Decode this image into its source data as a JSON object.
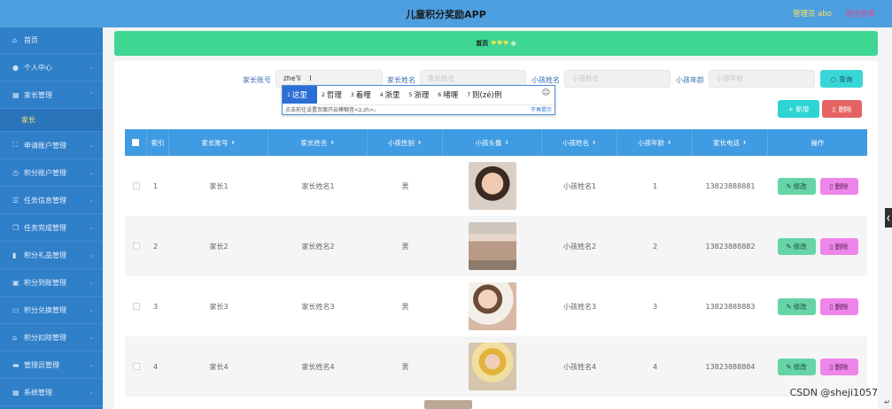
{
  "header": {
    "title": "儿童积分奖励APP",
    "admin": "管理员 abo",
    "logout": "退出登录"
  },
  "sidebar": {
    "items": [
      {
        "label": "首页",
        "icon": "home-icon"
      },
      {
        "label": "个人中心",
        "icon": "user-icon"
      },
      {
        "label": "家长管理",
        "icon": "grid-icon"
      },
      {
        "label": "家长",
        "sub": true
      },
      {
        "label": "申请账户管理",
        "icon": "expand-icon"
      },
      {
        "label": "积分账户管理",
        "icon": "clock-icon"
      },
      {
        "label": "任务信息管理",
        "icon": "list-icon"
      },
      {
        "label": "任务完成管理",
        "icon": "copy-icon"
      },
      {
        "label": "积分礼品管理",
        "icon": "bar-chart-icon"
      },
      {
        "label": "积分到账管理",
        "icon": "image-icon"
      },
      {
        "label": "积分兑换管理",
        "icon": "message-icon"
      },
      {
        "label": "积分扣除管理",
        "icon": "bank-icon"
      },
      {
        "label": "管理员管理",
        "icon": "card-icon"
      },
      {
        "label": "系统管理",
        "icon": "grid-icon"
      }
    ]
  },
  "breadcrumb": {
    "home": "首页",
    "hearts": "♥♥♥",
    "dot": "●"
  },
  "filters": {
    "parent_account_label": "家长账号",
    "parent_account_value": "zhe'li",
    "parent_name_label": "家长姓名",
    "parent_name_placeholder": "家长姓名",
    "child_name_label": "小孩姓名",
    "child_name_placeholder": "小孩姓名",
    "child_age_label": "小孩年龄",
    "child_age_placeholder": "小孩年龄",
    "search_label": "查询"
  },
  "ime": {
    "candidates": [
      {
        "n": "1",
        "text": "这里"
      },
      {
        "n": "2",
        "text": "哲理"
      },
      {
        "n": "3",
        "text": "着哩"
      },
      {
        "n": "4",
        "text": "浙里"
      },
      {
        "n": "5",
        "text": "浙理"
      },
      {
        "n": "6",
        "text": "啫喱"
      },
      {
        "n": "7",
        "text": "则(zé)例"
      }
    ],
    "hint": "点击前往设置页面开启模糊音<z,zh>。",
    "no_more": "不再提示",
    "emoji": "☺"
  },
  "actions": {
    "add_label": "+ 新增",
    "delete_label": "删除"
  },
  "table": {
    "headers": [
      "索引",
      "家长账号",
      "家长姓名",
      "小孩性别",
      "小孩头像",
      "小孩姓名",
      "小孩年龄",
      "家长电话",
      "操作"
    ],
    "rows": [
      {
        "index": "1",
        "account": "家长1",
        "name": "家长姓名1",
        "gender": "男",
        "child": "小孩姓名1",
        "age": "1",
        "phone": "13823888881"
      },
      {
        "index": "2",
        "account": "家长2",
        "name": "家长姓名2",
        "gender": "男",
        "child": "小孩姓名2",
        "age": "2",
        "phone": "13823888882"
      },
      {
        "index": "3",
        "account": "家长3",
        "name": "家长姓名3",
        "gender": "男",
        "child": "小孩姓名3",
        "age": "3",
        "phone": "13823888883"
      },
      {
        "index": "4",
        "account": "家长4",
        "name": "家长姓名4",
        "gender": "男",
        "child": "小孩姓名4",
        "age": "4",
        "phone": "13823888884"
      }
    ],
    "edit_label": "修改",
    "delete_label": "删除"
  },
  "watermark": "CSDN @sheji1057",
  "colors": {
    "topbar": "#4e9fe0",
    "sidebar": "#2f7fc9",
    "breadcrumb": "#3ed693",
    "table_header": "#3f9be2",
    "edit": "#66d4a6",
    "delete_row": "#ee86ea",
    "delete_bulk": "#e66363",
    "add": "#2ed4d4"
  }
}
